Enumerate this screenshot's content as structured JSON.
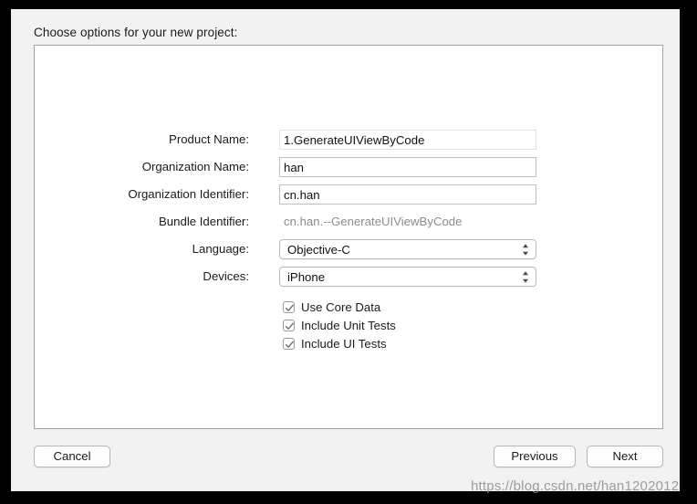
{
  "dialog": {
    "title": "Choose options for your new project:"
  },
  "form": {
    "fields": [
      {
        "label": "Product Name:",
        "value": "1.GenerateUIViewByCode",
        "type": "text",
        "focused": true
      },
      {
        "label": "Organization Name:",
        "value": "han",
        "type": "text",
        "focused": false
      },
      {
        "label": "Organization Identifier:",
        "value": "cn.han",
        "type": "text",
        "focused": false
      },
      {
        "label": "Bundle Identifier:",
        "value": "cn.han.--GenerateUIViewByCode",
        "type": "static"
      },
      {
        "label": "Language:",
        "value": "Objective-C",
        "type": "popup"
      },
      {
        "label": "Devices:",
        "value": "iPhone",
        "type": "popup"
      }
    ]
  },
  "checkboxes": [
    {
      "label": "Use Core Data",
      "checked": true
    },
    {
      "label": "Include Unit Tests",
      "checked": true
    },
    {
      "label": "Include UI Tests",
      "checked": true
    }
  ],
  "footer": {
    "cancel_label": "Cancel",
    "previous_label": "Previous",
    "next_label": "Next"
  },
  "watermark": {
    "text": "https://blog.csdn.net/han1202012"
  },
  "colors": {
    "window_background": "#f2f2f2",
    "panel_background": "#ffffff",
    "panel_border": "#a3a3a3",
    "text": "#1a1a1a",
    "disabled_text": "#8c8c8c",
    "field_border": "#bfbfbf",
    "outer_border": "#000000"
  }
}
